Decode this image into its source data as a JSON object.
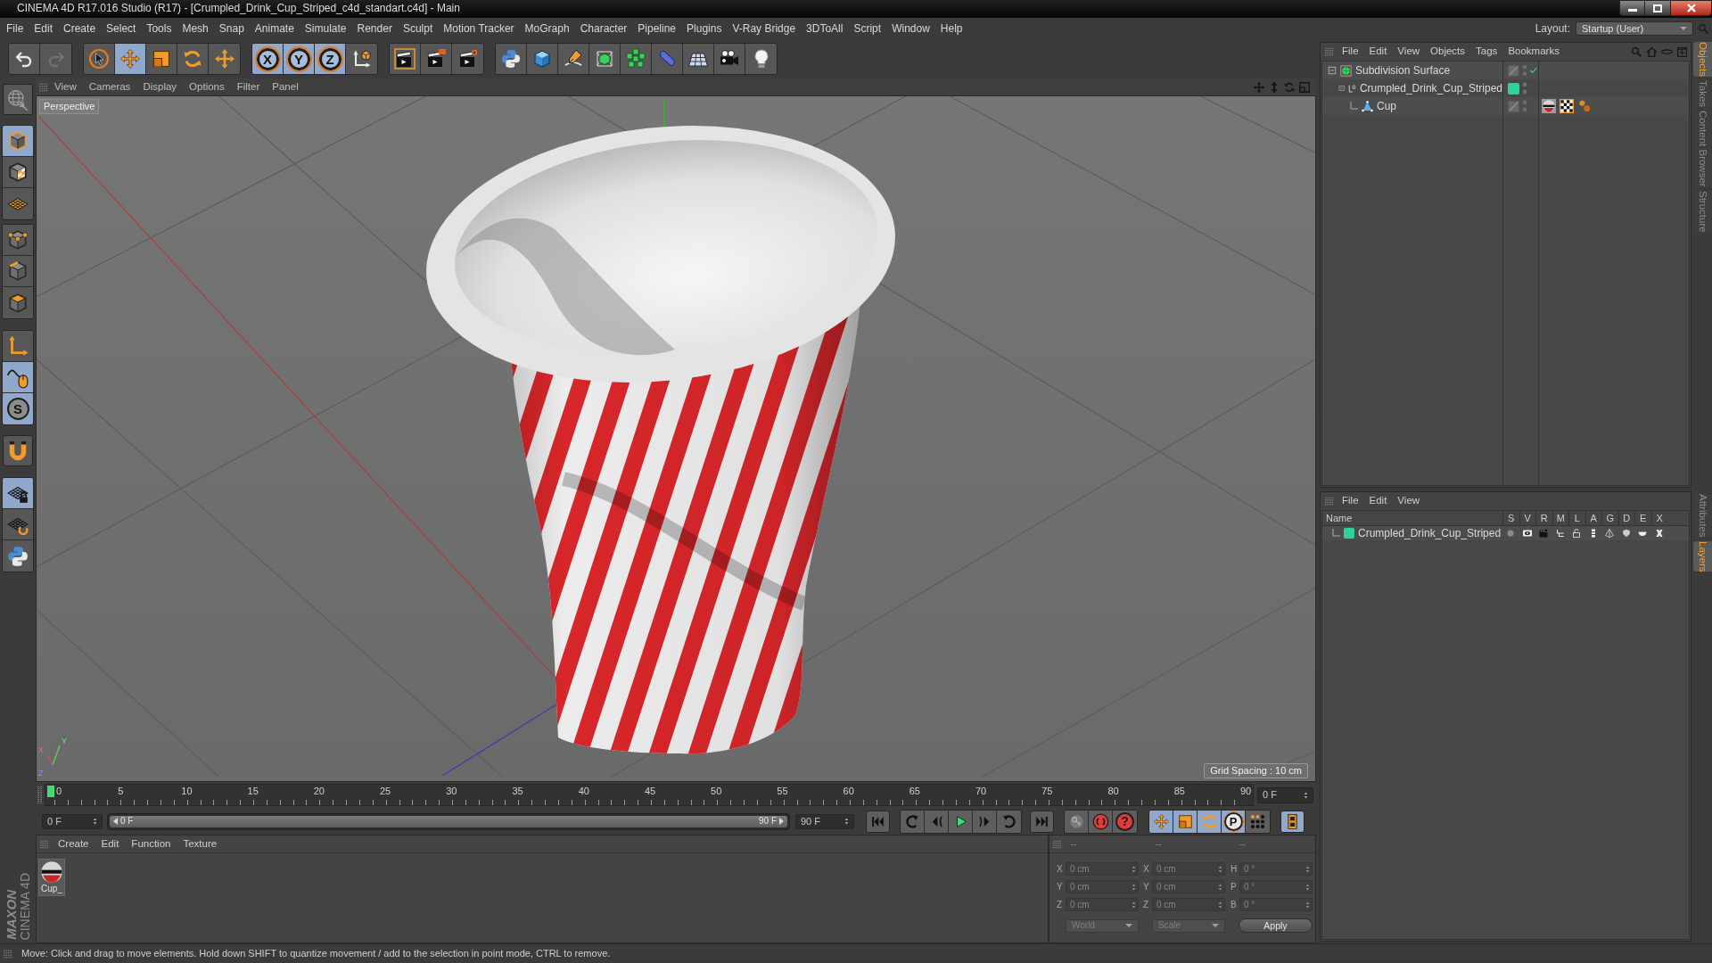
{
  "window": {
    "title": "CINEMA 4D R17.016 Studio (R17) - [Crumpled_Drink_Cup_Striped_c4d_standart.c4d] - Main"
  },
  "menu_bar": {
    "items": [
      "File",
      "Edit",
      "Create",
      "Select",
      "Tools",
      "Mesh",
      "Snap",
      "Animate",
      "Simulate",
      "Render",
      "Sculpt",
      "Motion Tracker",
      "MoGraph",
      "Character",
      "Pipeline",
      "Plugins",
      "V-Ray Bridge",
      "3DToAll",
      "Script",
      "Window",
      "Help"
    ],
    "layout_label": "Layout:",
    "layout": "Startup (User)"
  },
  "toolbar": [
    [
      {
        "kind": "undo",
        "selected": false
      },
      {
        "kind": "redo",
        "selected": false
      }
    ],
    [
      {
        "kind": "select",
        "selected": false
      },
      {
        "kind": "move",
        "selected": true
      },
      {
        "kind": "scale",
        "selected": false
      },
      {
        "kind": "rotate",
        "selected": false
      },
      {
        "kind": "recent_move",
        "selected": false
      }
    ],
    [
      {
        "kind": "axis_lock",
        "label": "X",
        "selected": true
      },
      {
        "kind": "axis_lock",
        "label": "Y",
        "selected": true
      },
      {
        "kind": "axis_lock",
        "label": "Z",
        "selected": true
      },
      {
        "kind": "coord_system",
        "selected": false
      }
    ],
    [
      {
        "kind": "render_view",
        "selected": false
      },
      {
        "kind": "render_picture",
        "selected": false
      },
      {
        "kind": "render_settings",
        "selected": false
      }
    ],
    [
      {
        "kind": "python",
        "selected": false
      },
      {
        "kind": "cube",
        "selected": false
      },
      {
        "kind": "pen",
        "selected": false
      },
      {
        "kind": "subdivision",
        "selected": false
      },
      {
        "kind": "cloner",
        "selected": false
      },
      {
        "kind": "deformer",
        "selected": false
      },
      {
        "kind": "floor",
        "selected": false
      },
      {
        "kind": "camera",
        "selected": false
      },
      {
        "kind": "light",
        "selected": false
      }
    ]
  ],
  "left_toolbar": [
    [
      {
        "kind": "make_editable",
        "selected": false
      }
    ],
    [
      {
        "kind": "model",
        "selected": true
      },
      {
        "kind": "texture",
        "selected": false
      },
      {
        "kind": "workplane",
        "selected": false
      }
    ],
    [
      {
        "kind": "points",
        "selected": false
      },
      {
        "kind": "edges",
        "selected": false
      },
      {
        "kind": "polygons",
        "selected": false
      }
    ],
    [
      {
        "kind": "axis",
        "selected": false
      },
      {
        "kind": "tweak",
        "selected": true
      },
      {
        "kind": "solo",
        "label": "S",
        "selected": true
      }
    ],
    [
      {
        "kind": "snap",
        "selected": false
      }
    ],
    [
      {
        "kind": "workplane_lock",
        "selected": true
      },
      {
        "kind": "workplane_rotate",
        "selected": false
      },
      {
        "kind": "python",
        "selected": false
      }
    ]
  ],
  "viewport": {
    "menu": [
      "View",
      "Cameras",
      "Display",
      "Options",
      "Filter",
      "Panel"
    ],
    "camera": "Perspective",
    "grid_spacing": "Grid Spacing : 10 cm",
    "axis_labels": [
      "Y",
      "X",
      "Z"
    ]
  },
  "timeline": {
    "ticks": [
      "0",
      "5",
      "10",
      "15",
      "20",
      "25",
      "30",
      "35",
      "40",
      "45",
      "50",
      "55",
      "60",
      "65",
      "70",
      "75",
      "80",
      "85",
      "90"
    ],
    "level": 0,
    "current_frame": "0 F"
  },
  "playback": {
    "start": "0 F",
    "range": {
      "start": "0 F",
      "end": "90 F",
      "level": 1
    },
    "end": "90 F",
    "buttons": [
      [
        {
          "kind": "to_start",
          "selected": false
        }
      ],
      [
        {
          "kind": "prev_key",
          "selected": false
        },
        {
          "kind": "prev_frame",
          "selected": false
        },
        {
          "kind": "play",
          "selected": false
        },
        {
          "kind": "next_frame",
          "selected": false
        },
        {
          "kind": "next_key",
          "selected": false
        }
      ],
      [
        {
          "kind": "to_end",
          "selected": false
        }
      ],
      [
        {
          "kind": "key",
          "selected": false
        },
        {
          "kind": "record",
          "selected": false
        },
        {
          "kind": "autokey",
          "label": "?",
          "selected": false
        }
      ],
      [
        {
          "kind": "move",
          "selected": true
        },
        {
          "kind": "scale",
          "selected": true
        },
        {
          "kind": "rotate",
          "selected": true
        },
        {
          "kind": "param",
          "label": "P",
          "selected": true
        },
        {
          "kind": "point_keys",
          "selected": false
        }
      ],
      [
        {
          "kind": "film",
          "selected": true
        }
      ]
    ]
  },
  "material_manager": {
    "menu": [
      "Create",
      "Edit",
      "Function",
      "Texture"
    ],
    "materials": [
      {
        "name": "Cup_"
      }
    ]
  },
  "coordinates": {
    "headers": [
      "--",
      "--",
      "--"
    ],
    "rows": [
      {
        "position_axis": "X",
        "position": "0 cm",
        "size_axis": "X",
        "size": "0 cm",
        "rotation_axis": "H",
        "rotation": "0 °"
      },
      {
        "position_axis": "Y",
        "position": "0 cm",
        "size_axis": "Y",
        "size": "0 cm",
        "rotation_axis": "P",
        "rotation": "0 °"
      },
      {
        "position_axis": "Z",
        "position": "0 cm",
        "size_axis": "Z",
        "size": "0 cm",
        "rotation_axis": "B",
        "rotation": "0 °"
      }
    ],
    "position_mode": "World",
    "size_mode": "Scale",
    "apply": "Apply"
  },
  "object_manager": {
    "menu": [
      "File",
      "Edit",
      "View",
      "Objects",
      "Tags",
      "Bookmarks"
    ],
    "objects": [
      {
        "name": "Subdivision Surface",
        "kind": "subdivision",
        "expanded": true,
        "enabled": true,
        "children": [
          {
            "name": "Crumpled_Drink_Cup_Striped",
            "kind": "null",
            "expanded": true,
            "color": "#2bd59a",
            "children": [
              {
                "name": "Cup",
                "kind": "polygon",
                "tags": [
                  {
                    "kind": "material"
                  },
                  {
                    "kind": "texture"
                  },
                  {
                    "kind": "phong"
                  }
                ]
              }
            ]
          }
        ]
      }
    ]
  },
  "layers": {
    "menu": [
      "File",
      "Edit",
      "View"
    ],
    "columns": [
      "Name",
      "S",
      "V",
      "R",
      "M",
      "L",
      "A",
      "G",
      "D",
      "E",
      "X"
    ],
    "rows": [
      {
        "name": "Crumpled_Drink_Cup_Striped",
        "color": "#2bd59a"
      }
    ]
  },
  "side_tabs": {
    "upper": [
      {
        "label": "Objects",
        "selected": true
      },
      {
        "label": "Takes",
        "selected": false
      },
      {
        "label": "Content Browser",
        "selected": false
      },
      {
        "label": "Structure",
        "selected": false
      }
    ],
    "lower": [
      {
        "label": "Attributes",
        "selected": false
      },
      {
        "label": "Layers",
        "selected": true
      }
    ]
  },
  "logo": {
    "brand": "MAXON",
    "product": "CINEMA 4D"
  },
  "status_bar": "Move: Click and drag to move elements. Hold down SHIFT to quantize movement / add to the selection in point mode, CTRL to remove."
}
